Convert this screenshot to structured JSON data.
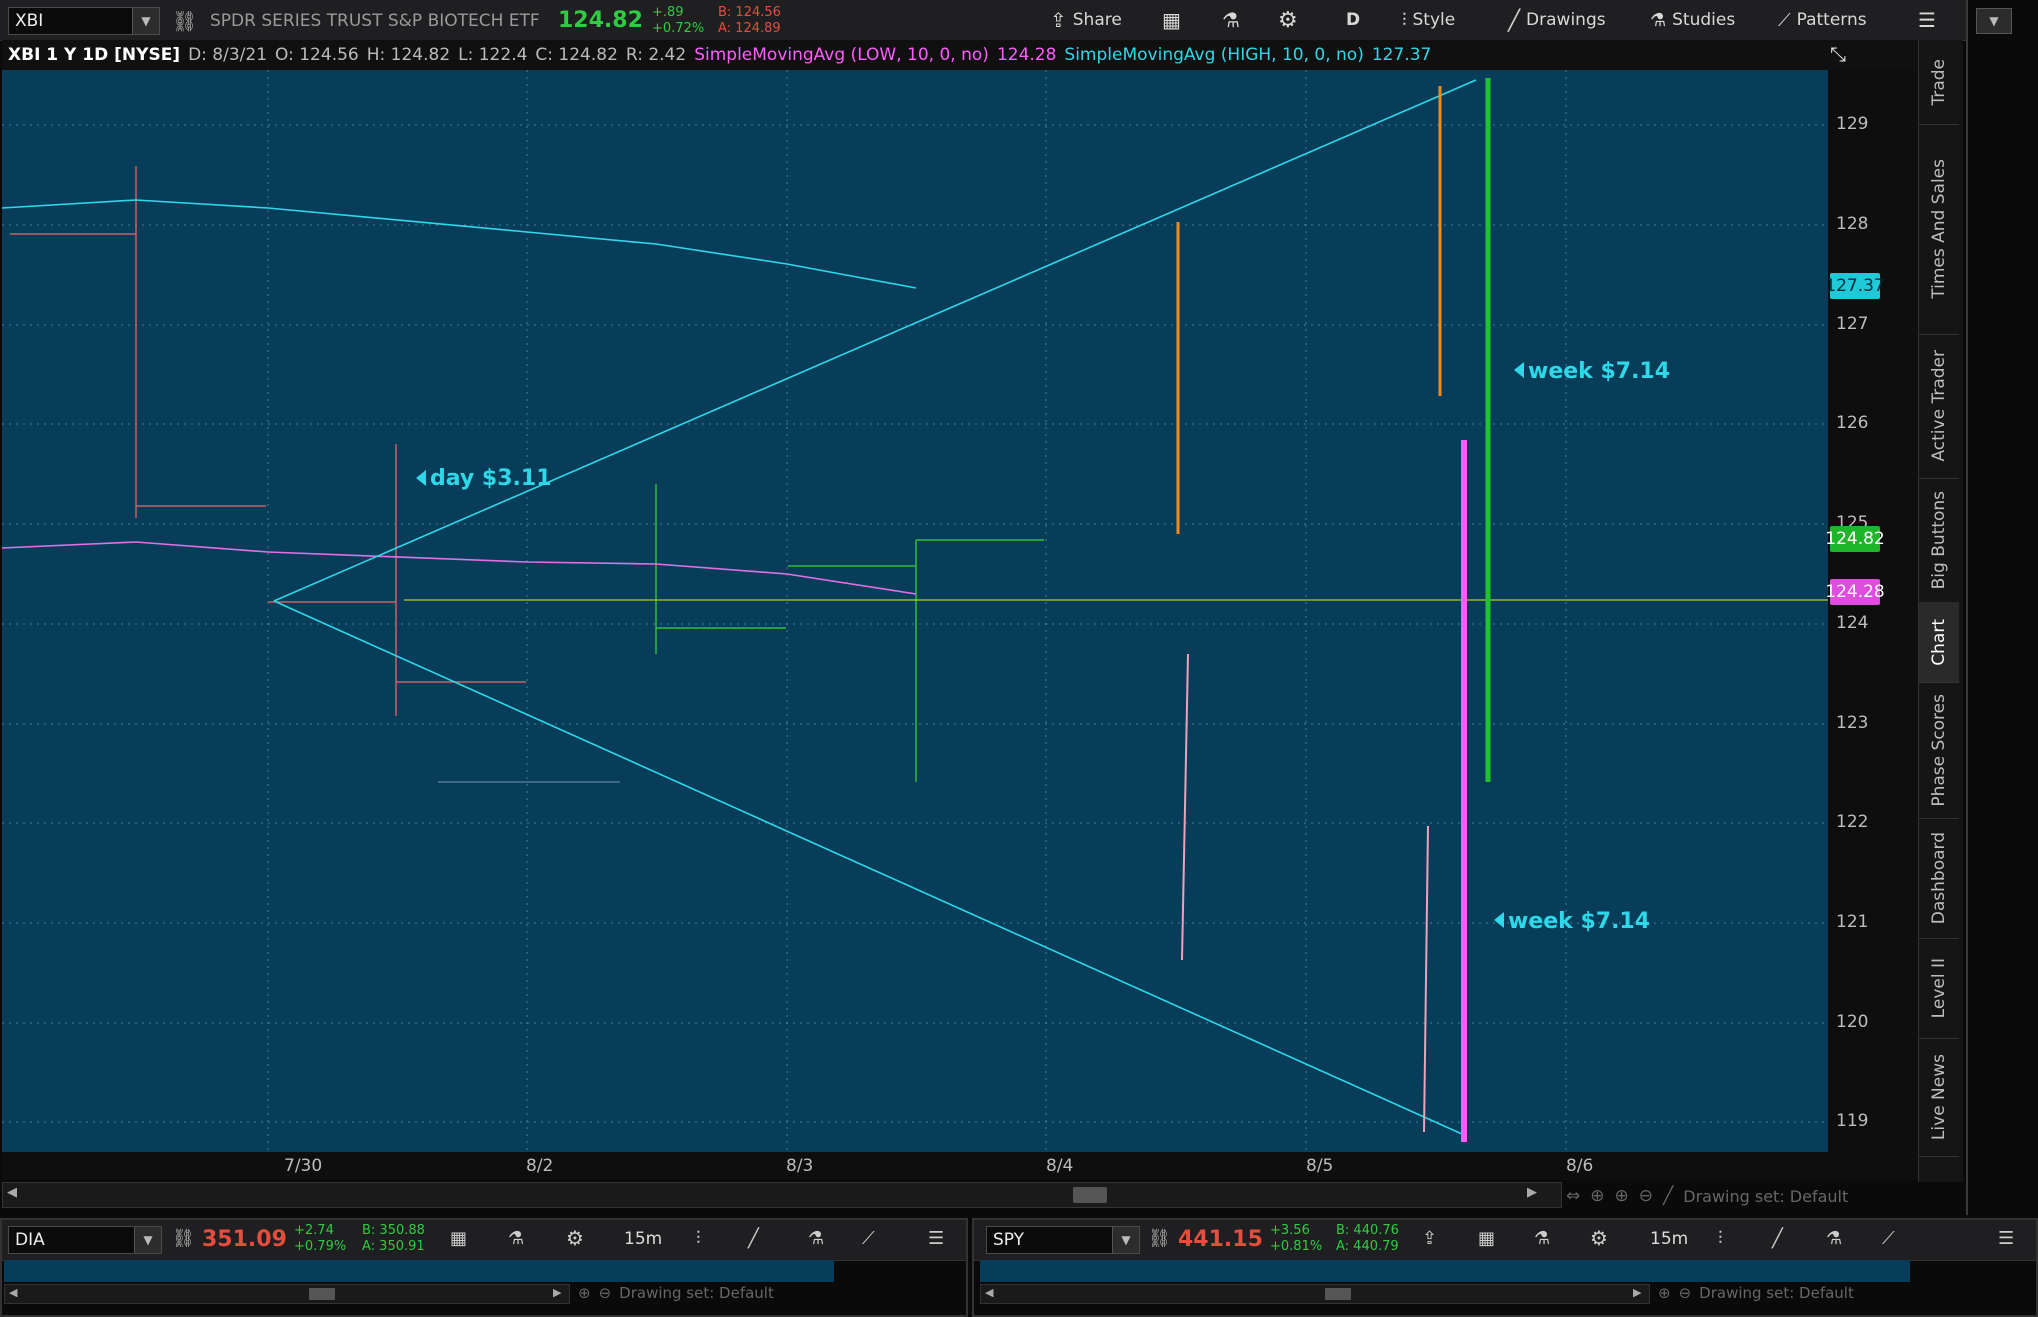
{
  "toolbar": {
    "symbol": "XBI",
    "description": "SPDR SERIES TRUST S&P BIOTECH ETF",
    "last": "124.82",
    "change": "+.89",
    "change_pct": "+0.72%",
    "bid": "B: 124.56",
    "ask": "A: 124.89",
    "share": "Share",
    "period": "D",
    "style": "Style",
    "drawings": "Drawings",
    "studies": "Studies",
    "patterns": "Patterns"
  },
  "header": {
    "title": "XBI 1 Y 1D [NYSE]",
    "date": "D: 8/3/21",
    "open": "O: 124.56",
    "high": "H: 124.82",
    "low": "L: 122.4",
    "close": "C: 124.82",
    "range": "R: 2.42",
    "sma_low": "SimpleMovingAvg (LOW, 10, 0, no)",
    "sma_low_value": "124.28",
    "sma_high": "SimpleMovingAvg (HIGH, 10, 0, no)",
    "sma_high_value": "127.37"
  },
  "axis": {
    "prices": [
      "129",
      "128",
      "127",
      "126",
      "125",
      "124",
      "123",
      "122",
      "121",
      "120",
      "119"
    ],
    "dates": [
      "7/30",
      "8/2",
      "8/3",
      "8/4",
      "8/5",
      "8/6"
    ],
    "tags": {
      "sma_high": "127.37",
      "last": "124.82",
      "sma_low": "124.28"
    }
  },
  "annotations": {
    "day": "day $3.11",
    "week1": "week $7.14",
    "week2": "week $7.14"
  },
  "side_tabs": [
    "Trade",
    "Times And Sales",
    "Active Trader",
    "Big Buttons",
    "Chart",
    "Phase Scores",
    "Dashboard",
    "Level II",
    "Live News"
  ],
  "status": {
    "drawing_set": "Drawing set: Default"
  },
  "mini_dia": {
    "symbol": "DIA",
    "last": "351.09",
    "change": "+2.74",
    "change_pct": "+0.79%",
    "bid": "B: 350.88",
    "ask": "A: 350.91",
    "period": "15m",
    "drawing_set": "Drawing set: Default"
  },
  "mini_spy": {
    "symbol": "SPY",
    "last": "441.15",
    "change": "+3.56",
    "change_pct": "+0.81%",
    "bid": "B: 440.76",
    "ask": "A: 440.79",
    "period": "15m",
    "drawing_set": "Drawing set: Default"
  },
  "colors": {
    "chart_bg": "#083d5a",
    "cyan": "#2fd8e8",
    "magenta": "#ff5cff",
    "green": "#22c22e",
    "orange": "#f08a1c",
    "last_tag": "#1fb52b",
    "sma_low_tag": "#e04ce0",
    "sma_high_tag": "#20c8d8"
  }
}
